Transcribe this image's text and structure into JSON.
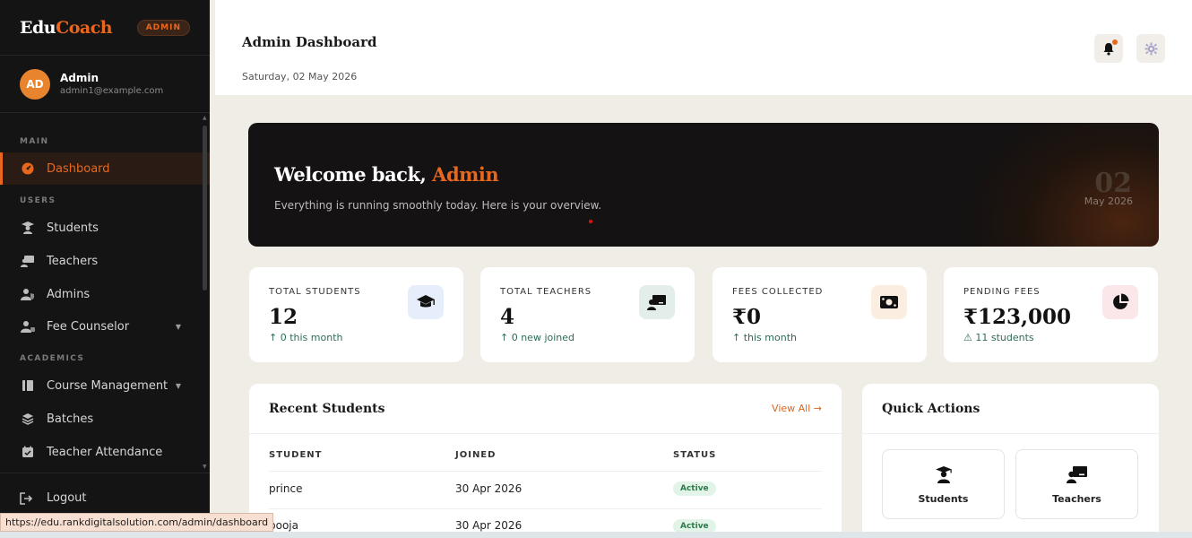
{
  "brand": {
    "part1": "Edu",
    "part2": "Coach",
    "role_badge": "ADMIN"
  },
  "user": {
    "initials": "AD",
    "name": "Admin",
    "email": "admin1@example.com"
  },
  "sidebar": {
    "sections": {
      "main": "MAIN",
      "users": "USERS",
      "academics": "ACADEMICS"
    },
    "items": {
      "dashboard": "Dashboard",
      "students": "Students",
      "teachers": "Teachers",
      "admins": "Admins",
      "fee_counselor": "Fee Counselor",
      "course_management": "Course Management",
      "batches": "Batches",
      "teacher_attendance": "Teacher Attendance"
    },
    "logout": "Logout"
  },
  "header": {
    "title": "Admin Dashboard",
    "date": "Saturday, 02 May 2026"
  },
  "hero": {
    "greeting": "Welcome back,",
    "name": "Admin",
    "subtitle": "Everything is running smoothly today. Here is your overview.",
    "day": "02",
    "month_year": "May 2026"
  },
  "stats": [
    {
      "label": "TOTAL STUDENTS",
      "value": "12",
      "trend": "↑ 0 this month"
    },
    {
      "label": "TOTAL TEACHERS",
      "value": "4",
      "trend": "↑ 0 new joined"
    },
    {
      "label": "FEES COLLECTED",
      "value": "₹0",
      "trend": "↑ this month"
    },
    {
      "label": "PENDING FEES",
      "value": "₹123,000",
      "trend": "⚠ 11 students"
    }
  ],
  "recent_students": {
    "title": "Recent Students",
    "view_all": "View All →",
    "columns": [
      "STUDENT",
      "JOINED",
      "STATUS"
    ],
    "rows": [
      {
        "name": "prince",
        "joined": "30 Apr 2026",
        "status": "Active"
      },
      {
        "name": "pooja",
        "joined": "30 Apr 2026",
        "status": "Active"
      }
    ]
  },
  "quick_actions": {
    "title": "Quick Actions",
    "tiles": [
      "Students",
      "Teachers"
    ]
  },
  "status_bar": {
    "url": "https://edu.rankdigitalsolution.com/admin/dashboard"
  },
  "colors": {
    "accent": "#e8671e",
    "sidebar_bg": "#141414",
    "page_bg": "#f0ece6",
    "success": "#2d7a4a"
  }
}
